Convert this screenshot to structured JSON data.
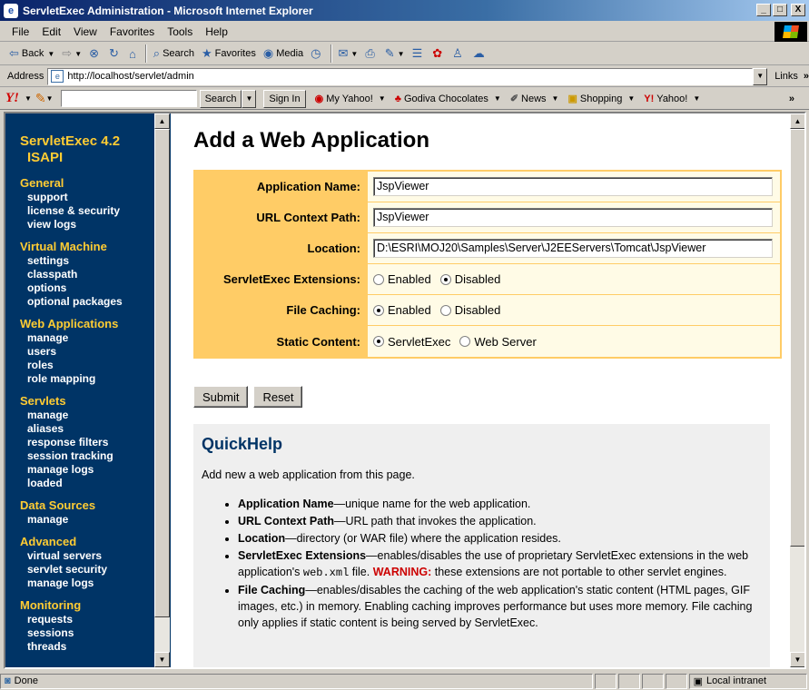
{
  "window": {
    "title": "ServletExec Administration - Microsoft Internet Explorer",
    "btn_min": "_",
    "btn_max": "□",
    "btn_close": "X"
  },
  "menu": [
    "File",
    "Edit",
    "View",
    "Favorites",
    "Tools",
    "Help"
  ],
  "toolbar": {
    "back": "Back",
    "search": "Search",
    "favorites": "Favorites",
    "media": "Media"
  },
  "address": {
    "label": "Address",
    "url": "http://localhost/servlet/admin",
    "links": "Links"
  },
  "yahoo": {
    "logo": "Y!",
    "search_btn": "Search",
    "signin": "Sign In",
    "my_yahoo": "My Yahoo!",
    "godiva": "Godiva Chocolates",
    "news": "News",
    "shopping": "Shopping",
    "yahoo": "Yahoo!"
  },
  "sidebar": {
    "title_line1": "ServletExec 4.2",
    "title_line2": "ISAPI",
    "sections": [
      {
        "name": "General",
        "items": [
          "support",
          "license & security",
          "view logs"
        ]
      },
      {
        "name": "Virtual Machine",
        "items": [
          "settings",
          "classpath",
          "options",
          "optional packages"
        ]
      },
      {
        "name": "Web Applications",
        "items": [
          "manage",
          "users",
          "roles",
          "role mapping"
        ]
      },
      {
        "name": "Servlets",
        "items": [
          "manage",
          "aliases",
          "response filters",
          "session tracking",
          "manage logs",
          "loaded"
        ]
      },
      {
        "name": "Data Sources",
        "items": [
          "manage"
        ]
      },
      {
        "name": "Advanced",
        "items": [
          "virtual servers",
          "servlet security",
          "manage logs"
        ]
      },
      {
        "name": "Monitoring",
        "items": [
          "requests",
          "sessions",
          "threads"
        ]
      }
    ]
  },
  "page": {
    "heading": "Add a Web Application",
    "fields": {
      "app_name_label": "Application Name:",
      "app_name_value": "JspViewer",
      "url_label": "URL Context Path:",
      "url_value": "JspViewer",
      "location_label": "Location:",
      "location_value": "D:\\ESRI\\MOJ20\\Samples\\Server\\J2EEServers\\Tomcat\\JspViewer",
      "ext_label": "ServletExec Extensions:",
      "ext_enabled": "Enabled",
      "ext_disabled": "Disabled",
      "cache_label": "File Caching:",
      "cache_enabled": "Enabled",
      "cache_disabled": "Disabled",
      "static_label": "Static Content:",
      "static_servletexec": "ServletExec",
      "static_webserver": "Web Server"
    },
    "submit": "Submit",
    "reset": "Reset",
    "quickhelp": {
      "title": "QuickHelp",
      "intro": "Add new a web application from this page.",
      "items": [
        {
          "term": "Application Name",
          "text": "—unique name for the web application."
        },
        {
          "term": "URL Context Path",
          "text": "—URL path that invokes the application."
        },
        {
          "term": "Location",
          "text": "—directory (or WAR file) where the application resides."
        },
        {
          "term": "ServletExec Extensions",
          "text": "—enables/disables the use of proprietary ServletExec extensions in the web application's ",
          "code": "web.xml",
          "text2": " file. ",
          "warn": "WARNING:",
          "text3": " these extensions are not portable to other servlet engines."
        },
        {
          "term": "File Caching",
          "text": "—enables/disables the caching of the web application's static content (HTML pages, GIF images, etc.) in memory. Enabling caching improves performance but uses more memory. File caching only applies if static content is being served by ServletExec."
        }
      ]
    }
  },
  "status": {
    "text": "Done",
    "zone": "Local intranet"
  }
}
